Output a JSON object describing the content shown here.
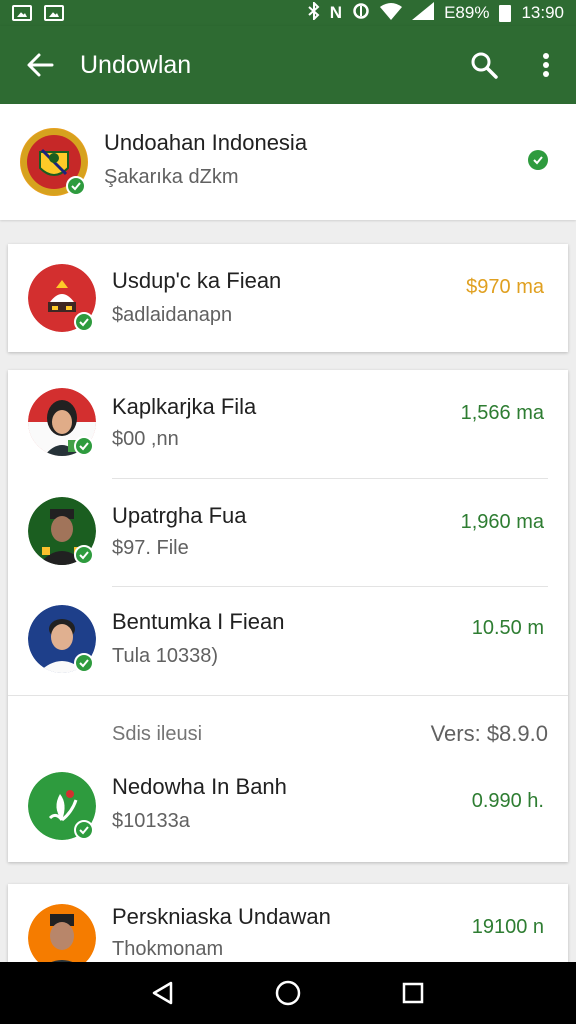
{
  "status_bar": {
    "battery": "E89%",
    "time": "13:90",
    "network": "N"
  },
  "app_bar": {
    "title": "Undowlan"
  },
  "header_item": {
    "name": "Undoahan Indonesia",
    "subtitle": "Şakarıka dZkm"
  },
  "items": [
    {
      "name": "Usdup'c ka Fiean",
      "subtitle": "$adlaidanapn",
      "amount": "$970 ma"
    },
    {
      "name": "Kaplkarjka Fila",
      "subtitle": "$00 ,nn",
      "amount": "1,566 ma"
    },
    {
      "name": "Upatrgha Fua",
      "subtitle": "$97. File",
      "amount": "1,960 ma"
    },
    {
      "name": "Bentumka I Fiean",
      "subtitle": "Tula 10338)",
      "amount": "10.50 m"
    },
    {
      "name": "Nedowha In Banh",
      "subtitle": "$10133a",
      "amount": "0.990 h."
    },
    {
      "name": "Perskniaska Undawan",
      "subtitle": "Thokmonam",
      "amount": "19100 n"
    }
  ],
  "section": {
    "label": "Sdis ileusi",
    "version": "Vers: $8.9.0"
  },
  "colors": {
    "primary": "#2e6b32",
    "accent_green": "#2e7d32",
    "gold": "#e0a020",
    "check": "#2e9b3e"
  },
  "icons": [
    "back-arrow-icon",
    "search-icon",
    "more-vert-icon",
    "check-icon",
    "back-triangle-icon",
    "home-circle-icon",
    "recents-square-icon"
  ]
}
